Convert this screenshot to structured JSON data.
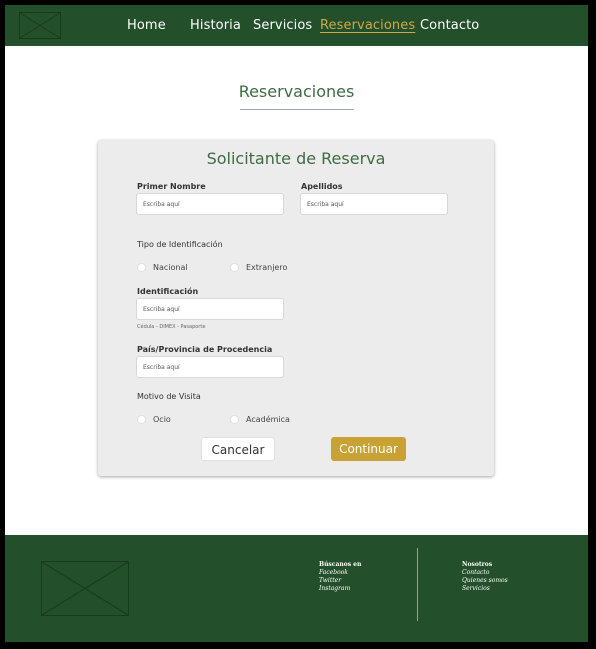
{
  "colors": {
    "brand_green": "#234f2a",
    "accent_gold": "#c9a235",
    "heading_green": "#3f6b44",
    "card_bg": "#ececec"
  },
  "header": {
    "logo": "image-placeholder",
    "nav": [
      {
        "label": "Home",
        "active": false
      },
      {
        "label": "Historia",
        "active": false
      },
      {
        "label": "Servicios",
        "active": false
      },
      {
        "label": "Reservaciones",
        "active": true
      },
      {
        "label": "Contacto",
        "active": false
      }
    ]
  },
  "page": {
    "title": "Reservaciones"
  },
  "form": {
    "title": "Solicitante de Reserva",
    "first_name": {
      "label": "Primer Nombre",
      "placeholder": "Escriba aquí"
    },
    "last_name": {
      "label": "Apellidos",
      "placeholder": "Escriba aquí"
    },
    "id_type": {
      "label": "Tipo de Identificación",
      "options": [
        "Nacional",
        "Extranjero"
      ]
    },
    "identification": {
      "label": "Identificación",
      "placeholder": "Escriba aquí",
      "hint": "Cédula - DIMEX - Pasaporte"
    },
    "origin": {
      "label": "País/Provincia de Procedencia",
      "placeholder": "Escriba aquí"
    },
    "visit_reason": {
      "label": "Motivo de Visita",
      "options": [
        "Ocio",
        "Académica"
      ]
    },
    "cancel_label": "Cancelar",
    "continue_label": "Continuar"
  },
  "footer": {
    "logo": "image-placeholder",
    "social": {
      "heading": "Búscanos en",
      "items": [
        "Facebook",
        "Twitter",
        "Instagram"
      ]
    },
    "about": {
      "heading": "Nosotros",
      "items": [
        "Contacto",
        "Quienes somos",
        "Servicios"
      ]
    }
  }
}
